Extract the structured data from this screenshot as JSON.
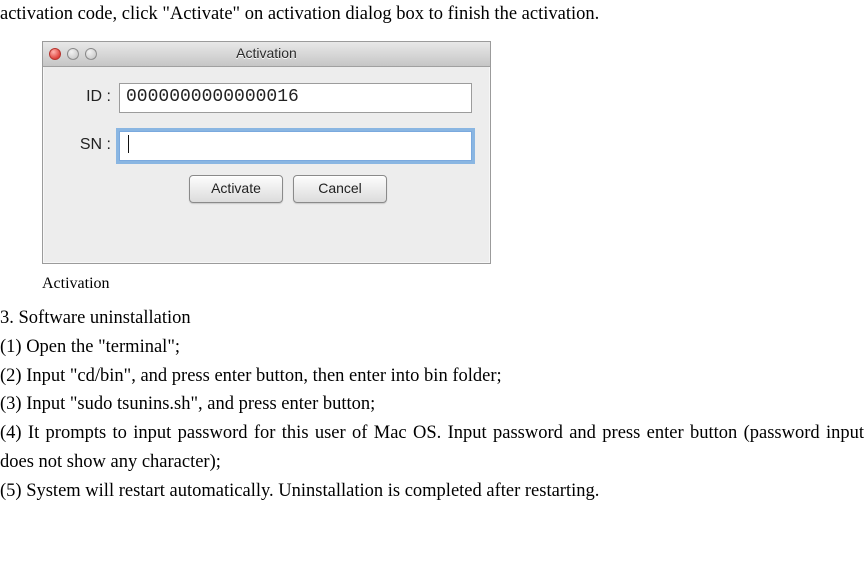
{
  "doc": {
    "lead_text": "activation code, click \"Activate\" on activation dialog box to finish the activation.",
    "figure_caption": "Activation",
    "heading": "3. Software uninstallation",
    "steps": [
      "(1) Open the \"terminal\";",
      "(2) Input \"cd/bin\", and press enter button, then enter into bin folder;",
      "(3) Input \"sudo tsunins.sh\", and press enter button;",
      "(4) It prompts to input password for this user of Mac OS. Input password and press enter button (password input does not show any character);",
      "(5) System will restart automatically. Uninstallation is completed after restarting."
    ]
  },
  "dialog": {
    "title": "Activation",
    "id_label": "ID :",
    "id_value": "0000000000000016",
    "sn_label": "SN :",
    "sn_value": "",
    "activate_label": "Activate",
    "cancel_label": "Cancel"
  }
}
